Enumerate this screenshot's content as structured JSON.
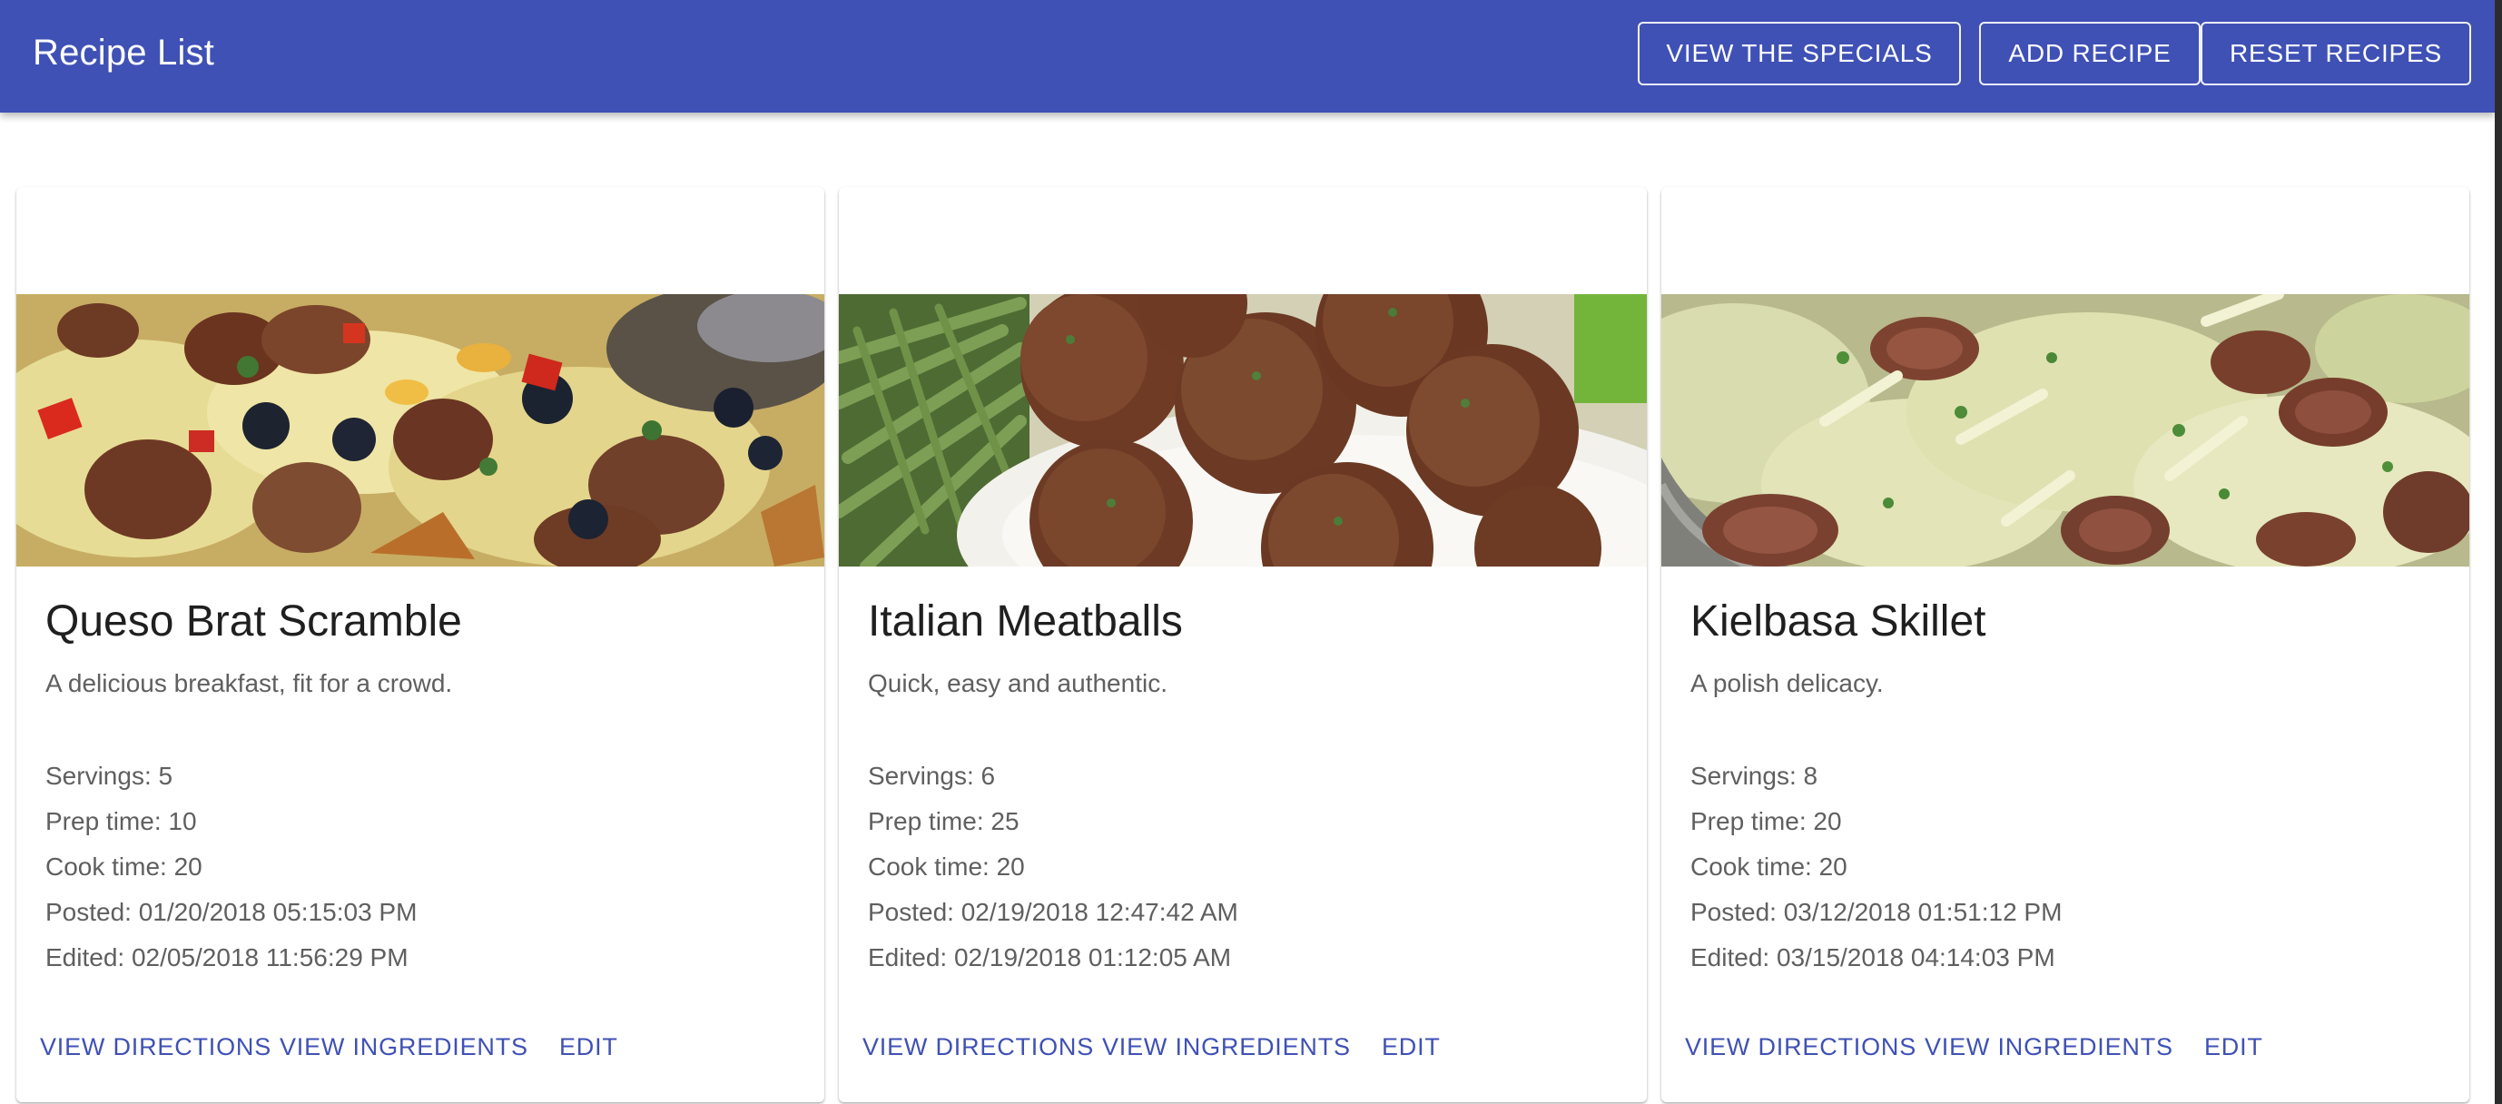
{
  "app": {
    "title": "Recipe List",
    "accent_color": "#3f51b5"
  },
  "toolbar": {
    "specials_label": "VIEW THE SPECIALS",
    "add_label": "ADD RECIPE",
    "reset_label": "RESET RECIPES"
  },
  "recipes": [
    {
      "title": "Queso Brat Scramble",
      "description": "A delicious breakfast, fit for a crowd.",
      "servings": "Servings: 5",
      "prep": "Prep time: 10",
      "cook": "Cook time: 20",
      "posted": "Posted: 01/20/2018 05:15:03 PM",
      "edited": "Edited: 02/05/2018 11:56:29 PM"
    },
    {
      "title": "Italian Meatballs",
      "description": "Quick, easy and authentic.",
      "servings": "Servings: 6",
      "prep": "Prep time: 25",
      "cook": "Cook time: 20",
      "posted": "Posted: 02/19/2018 12:47:42 AM",
      "edited": "Edited: 02/19/2018 01:12:05 AM"
    },
    {
      "title": "Kielbasa Skillet",
      "description": "A polish delicacy.",
      "servings": "Servings: 8",
      "prep": "Prep time: 20",
      "cook": "Cook time: 20",
      "posted": "Posted: 03/12/2018 01:51:12 PM",
      "edited": "Edited: 03/15/2018 04:14:03 PM"
    }
  ],
  "card_actions": {
    "directions_label": "VIEW DIRECTIONS",
    "ingredients_label": "VIEW INGREDIENTS",
    "edit_label": "EDIT"
  }
}
